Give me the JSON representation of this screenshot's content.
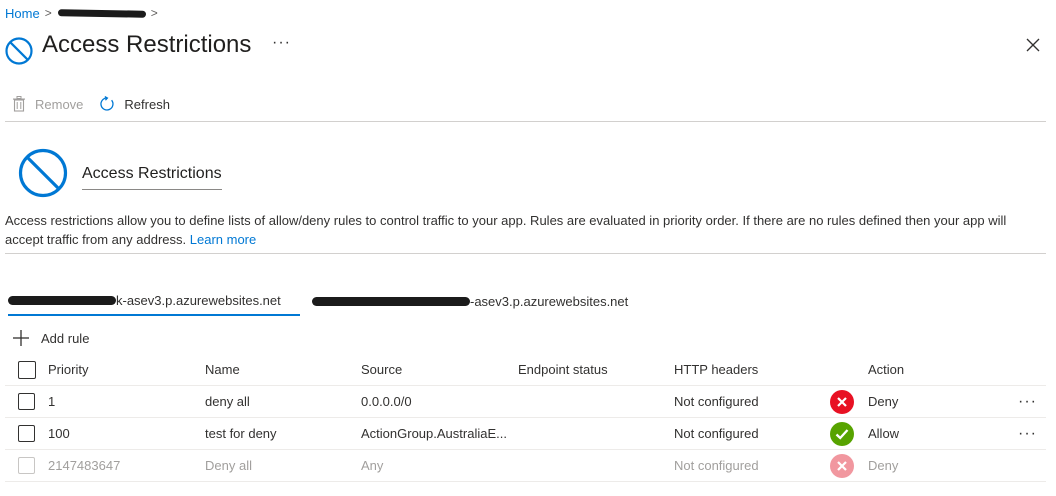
{
  "breadcrumb": {
    "home": "Home",
    "separator": ">"
  },
  "page": {
    "title": "Access Restrictions",
    "more": "···"
  },
  "toolbar": {
    "remove_label": "Remove",
    "refresh_label": "Refresh"
  },
  "section": {
    "title": "Access Restrictions",
    "description": "Access restrictions allow you to define lists of allow/deny rules to control traffic to your app. Rules are evaluated in priority order. If there are no rules defined then your app will accept traffic from any address.",
    "learn_more": "Learn more"
  },
  "tabs": [
    {
      "label": "k-asev3.p.azurewebsites.net",
      "active": true
    },
    {
      "label": "-asev3.p.azurewebsites.net",
      "active": false
    }
  ],
  "add_rule_label": "Add rule",
  "table": {
    "columns": [
      "Priority",
      "Name",
      "Source",
      "Endpoint status",
      "HTTP headers",
      "Action"
    ],
    "rows": [
      {
        "priority": "1",
        "name": "deny all",
        "source": "0.0.0.0/0",
        "endpoint_status": "",
        "http_headers": "Not configured",
        "action": "Deny",
        "more": "···"
      },
      {
        "priority": "100",
        "name": "test for deny",
        "source": "ActionGroup.AustraliaE...",
        "endpoint_status": "",
        "http_headers": "Not configured",
        "action": "Allow",
        "more": "···"
      },
      {
        "priority": "2147483647",
        "name": "Deny all",
        "source": "Any",
        "endpoint_status": "",
        "http_headers": "Not configured",
        "action": "Deny"
      }
    ]
  },
  "colors": {
    "accent": "#0078d4",
    "deny": "#e81123",
    "allow": "#57a300",
    "text": "#323130",
    "disabled": "#a19f9d"
  }
}
